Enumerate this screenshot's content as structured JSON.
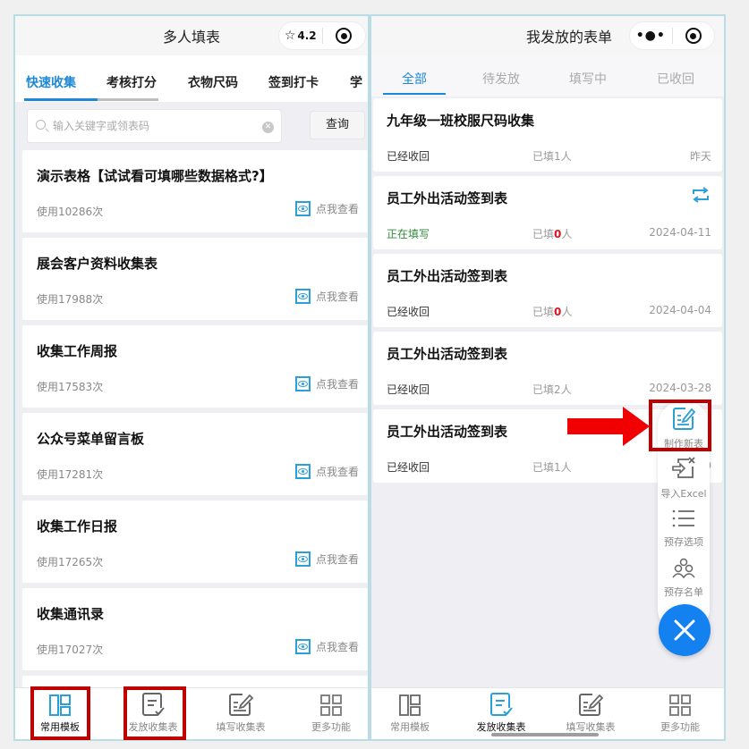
{
  "left_screen": {
    "navbar": {
      "title": "多人填表",
      "rating": "4.2"
    },
    "tabs": [
      {
        "label": "快速收集",
        "active": true
      },
      {
        "label": "考核打分",
        "active": false
      },
      {
        "label": "衣物尺码",
        "active": false
      },
      {
        "label": "签到打卡",
        "active": false
      },
      {
        "label": "学",
        "active": false
      }
    ],
    "search": {
      "placeholder": "输入关键字或领表码",
      "value": "",
      "button_label": "查询"
    },
    "templates": [
      {
        "title": "演示表格【试试看可填哪些数据格式?】",
        "usage": "使用10286次",
        "view_label": "点我查看"
      },
      {
        "title": "展会客户资料收集表",
        "usage": "使用17988次",
        "view_label": "点我查看"
      },
      {
        "title": "收集工作周报",
        "usage": "使用17583次",
        "view_label": "点我查看"
      },
      {
        "title": "公众号菜单留言板",
        "usage": "使用17281次",
        "view_label": "点我查看"
      },
      {
        "title": "收集工作日报",
        "usage": "使用17265次",
        "view_label": "点我查看"
      },
      {
        "title": "收集通讯录",
        "usage": "使用17027次",
        "view_label": "点我查看"
      }
    ],
    "tabbar": [
      {
        "label": "常用模板",
        "active": true
      },
      {
        "label": "发放收集表",
        "active": false
      },
      {
        "label": "填写收集表",
        "active": false
      },
      {
        "label": "更多功能",
        "active": false
      }
    ]
  },
  "right_screen": {
    "navbar": {
      "title": "我发放的表单"
    },
    "tabs": [
      {
        "label": "全部",
        "active": true
      },
      {
        "label": "待发放",
        "active": false
      },
      {
        "label": "填写中",
        "active": false
      },
      {
        "label": "已收回",
        "active": false
      }
    ],
    "forms": [
      {
        "title": "九年级一班校服尺码收集",
        "status": "已经收回",
        "status_type": "collected",
        "count_prefix": "已填",
        "count": "1",
        "count_suffix": "人",
        "date": "昨天",
        "has_swap_icon": false
      },
      {
        "title": "员工外出活动签到表",
        "status": "正在填写",
        "status_type": "filling",
        "count_prefix": "已填",
        "count": "0",
        "count_suffix": "人",
        "date": "2024-04-11",
        "has_swap_icon": true
      },
      {
        "title": "员工外出活动签到表",
        "status": "已经收回",
        "status_type": "collected",
        "count_prefix": "已填",
        "count": "0",
        "count_suffix": "人",
        "date": "2024-04-04",
        "has_swap_icon": false
      },
      {
        "title": "员工外出活动签到表",
        "status": "已经收回",
        "status_type": "collected",
        "count_prefix": "已填",
        "count": "2",
        "count_suffix": "人",
        "date": "2024-03-28",
        "has_swap_icon": false
      },
      {
        "title": "员工外出活动签到表",
        "status": "已经收回",
        "status_type": "collected",
        "count_prefix": "已填",
        "count": "1",
        "count_suffix": "人",
        "date": "2024-0",
        "has_swap_icon": false
      }
    ],
    "fab_menu": [
      {
        "label": "制作新表",
        "icon": "create-form-icon"
      },
      {
        "label": "导入Excel",
        "icon": "import-excel-icon"
      },
      {
        "label": "预存选项",
        "icon": "list-icon"
      },
      {
        "label": "预存名单",
        "icon": "people-icon"
      }
    ],
    "tabbar": [
      {
        "label": "常用模板",
        "active": false
      },
      {
        "label": "发放收集表",
        "active": true
      },
      {
        "label": "填写收集表",
        "active": false
      },
      {
        "label": "更多功能",
        "active": false
      }
    ]
  },
  "colors": {
    "accent": "#1e88d8",
    "annotation_red": "#c00000",
    "zero_count": "#e0141e",
    "filling_status": "#2e8b3a",
    "fab_blue": "#1382f0"
  }
}
